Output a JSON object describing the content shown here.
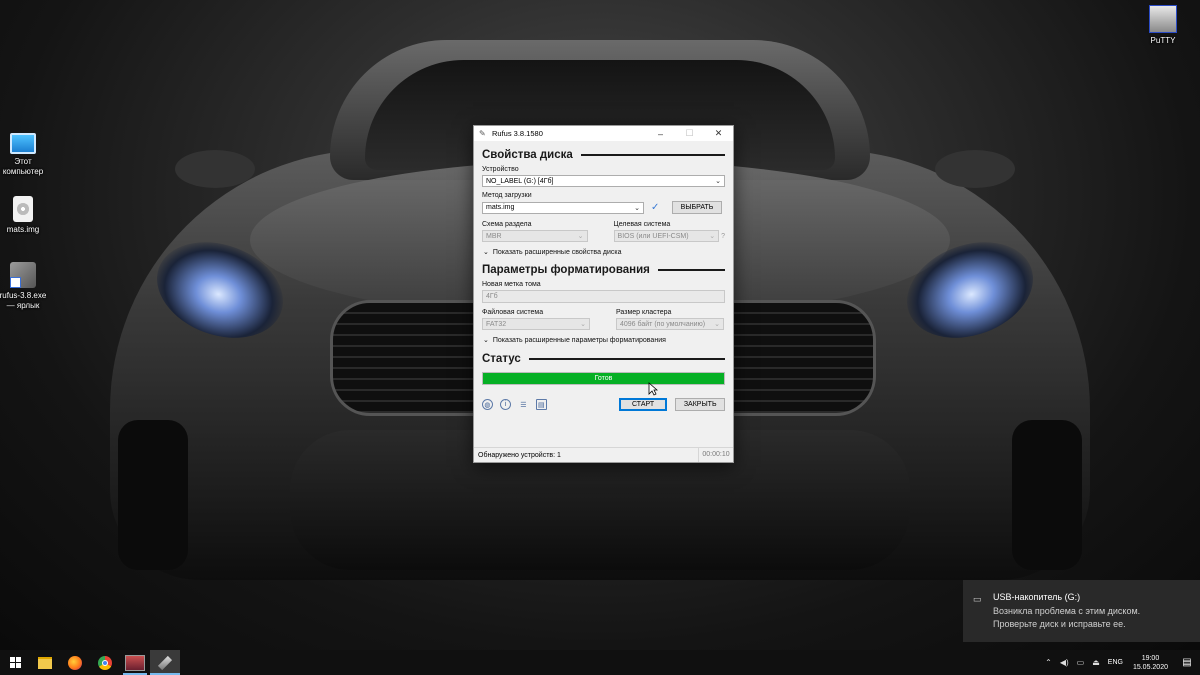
{
  "desktop": {
    "icons": [
      {
        "name": "this-pc",
        "line1": "Этот",
        "line2": "компьютер"
      },
      {
        "name": "mats-img",
        "line1": "mats.img",
        "line2": ""
      },
      {
        "name": "rufus-shortcut",
        "line1": "rufus-3.8.exe",
        "line2": "— ярлык"
      },
      {
        "name": "putty",
        "line1": "PuTTY",
        "line2": ""
      }
    ]
  },
  "rufus": {
    "title": "Rufus 3.8.1580",
    "drive_section": "Свойства диска",
    "device_label": "Устройство",
    "device_value": "NO_LABEL (G:) [4Гб]",
    "boot_label": "Метод загрузки",
    "boot_value": "mats.img",
    "select_button": "ВЫБРАТЬ",
    "partition_label": "Схема раздела",
    "partition_value": "MBR",
    "target_label": "Целевая система",
    "target_value": "BIOS (или UEFI-CSM)",
    "help_mark": "?",
    "advanced_drive": "Показать расширенные свойства диска",
    "format_section": "Параметры форматирования",
    "volume_label": "Новая метка тома",
    "volume_value": "4Гб",
    "fs_label": "Файловая система",
    "fs_value": "FAT32",
    "cluster_label": "Размер кластера",
    "cluster_value": "4096 байт (по умолчанию)",
    "advanced_format": "Показать расширенные параметры форматирования",
    "status_section": "Статус",
    "progress_text": "Готов",
    "progress_fraction": 1.0,
    "start_button": "СТАРТ",
    "close_button": "ЗАКРЫТЬ",
    "status_message": "Обнаружено устройств: 1",
    "elapsed": "00:00:10"
  },
  "toast": {
    "title": "USB-накопитель (G:)",
    "line1": "Возникла проблема с этим диском.",
    "line2": "Проверьте диск и исправьте ее."
  },
  "tray": {
    "language": "ENG",
    "time": "19:00",
    "date": "15.05.2020"
  },
  "colors": {
    "progress_green": "#06b025",
    "accent_blue": "#0078d7"
  }
}
